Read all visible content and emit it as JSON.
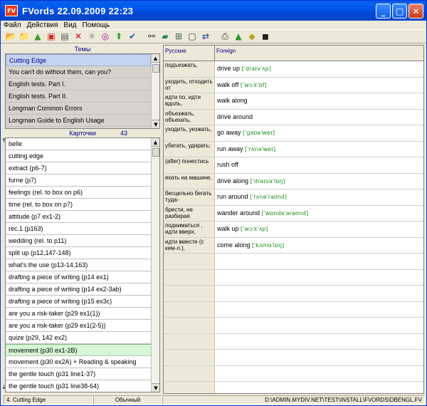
{
  "window": {
    "title": "FVords   22.09.2009  22:23",
    "app_icon": "FV",
    "btn_minimize": "_",
    "btn_maximize": "□",
    "btn_close": "✕"
  },
  "menu": [
    "Файл",
    "Действия",
    "Вид",
    "Помощь"
  ],
  "toolbar": [
    {
      "name": "open-folder-icon",
      "glyph": "📂",
      "color": "#d8a020"
    },
    {
      "name": "folder-icon",
      "glyph": "📁",
      "color": "#d8a020"
    },
    {
      "name": "tree-icon",
      "glyph": "▲",
      "color": "#3a9a2a"
    },
    {
      "name": "add-card-icon",
      "glyph": "▣",
      "color": "#d02828"
    },
    {
      "name": "list-icon",
      "glyph": "▤",
      "color": "#555555"
    },
    {
      "name": "delete-icon",
      "glyph": "✕",
      "color": "#c01010"
    },
    {
      "name": "star-icon",
      "glyph": "✳",
      "color": "#888888"
    },
    {
      "name": "target-icon",
      "glyph": "◎",
      "color": "#a020a0"
    },
    {
      "name": "arrow-up-icon",
      "glyph": "⬆",
      "color": "#22a022"
    },
    {
      "name": "check-icon",
      "glyph": "✔",
      "color": "#2050c0"
    },
    {
      "name": "binoculars-icon",
      "glyph": "⚯",
      "color": "#333333"
    },
    {
      "name": "book-icon",
      "glyph": "▰",
      "color": "#208050"
    },
    {
      "name": "grid-icon",
      "glyph": "⊞",
      "color": "#406040"
    },
    {
      "name": "window-icon",
      "glyph": "▢",
      "color": "#404040"
    },
    {
      "name": "swap-icon",
      "glyph": "⇄",
      "color": "#1a3a9a"
    },
    {
      "name": "print-icon",
      "glyph": "⎙",
      "color": "#404040"
    },
    {
      "name": "export-icon",
      "glyph": "▲",
      "color": "#2a9a2a"
    },
    {
      "name": "import-icon",
      "glyph": "◆",
      "color": "#c0a020"
    },
    {
      "name": "save-icon",
      "glyph": "◼",
      "color": "#202020"
    }
  ],
  "themes": {
    "header": "Темы",
    "items": [
      "Cutting Edge",
      "You can't do without them, can you?",
      "English tests. Part I.",
      "English tests. Part II.",
      "Longman Common Errors",
      "Longman Guide to English Usage"
    ]
  },
  "cards": {
    "header": "Карточки",
    "count": "43",
    "items": [
      "belle",
      "cutting edge",
      "extract (p6-7)",
      "furne (p7)",
      "feelings (rel. to box on p6)",
      "time (rel. to box on p7)",
      "attitude (p7 ex1-2)",
      "rec.1 (p163)",
      "wedding (rel. to p11)",
      "split up (p12,147-148)",
      "what's the use (p13-14,163)",
      "drafting a piece of writing (p14 ex1)",
      "drafting a piece of writing (p14 ex2-3ab)",
      "drafting a piece of writing (p15 ex3c)",
      "are you a risk-taker (p29 ex1(1))",
      "are you a risk-taker (p29 ex1(2-5))",
      "quize (p29, 142 ex2)",
      "movement (p30 ex1-2B)",
      "movement (p30 ex2A) + Reading & speaking",
      "the gentle touch (p31 line1-37)",
      "the gentle touch (p31 line38-64)"
    ]
  },
  "table": {
    "col_russian": "Русские",
    "col_foreign": "Foreign",
    "rows": [
      {
        "ru": "подъезжать,",
        "en": "drive up",
        "tr": "[ˈdraɪvˈʌp]"
      },
      {
        "ru": "уходить, отходить от",
        "en": "walk off",
        "tr": "[ˈwɔːkˈɒf]"
      },
      {
        "ru": "идти по, идти вдоль,",
        "en": "walk along",
        "tr": ""
      },
      {
        "ru": "объезжать, объехать,",
        "en": "drive around",
        "tr": ""
      },
      {
        "ru": "уходить, уезжать,",
        "en": "go away",
        "tr": "[ˈɡəʊəˈweɪ]"
      },
      {
        "ru": "убегать, удирать;",
        "en": "run away",
        "tr": "[ˈrʌnəˈweɪ]"
      },
      {
        "ru": "(after) понестись",
        "en": "rush off",
        "tr": ""
      },
      {
        "ru": "ехать на машине,",
        "en": "drive along",
        "tr": "[ˈdraɪvəˈlɒŋ]"
      },
      {
        "ru": "бесцельно бегать туда-",
        "en": "run around",
        "tr": "[ˈrʌnəˈraʊnd]"
      },
      {
        "ru": "брести, не разбирая",
        "en": "wander around",
        "tr": "[ˈwɒndəˈəraʊnd]"
      },
      {
        "ru": "подниматься , идти вверх,",
        "en": "walk up",
        "tr": "[ˈwɔːkˈʌp]"
      },
      {
        "ru": "идти вместе (с кем-л.),",
        "en": "come along",
        "tr": "[ˈkʌməˈlɒŋ]"
      }
    ]
  },
  "status": {
    "left": "4. Cutting Edge",
    "mid": "Обычный",
    "right": "D:\\ADMIN.MYDIV.NET\\TEST\\INSTALL\\FVORDS\\DBENGL.FV"
  },
  "colors": {
    "selection_green": "#d5f5d5",
    "transcription_green": "#1d8f1d",
    "header_blue": "#00008b"
  }
}
